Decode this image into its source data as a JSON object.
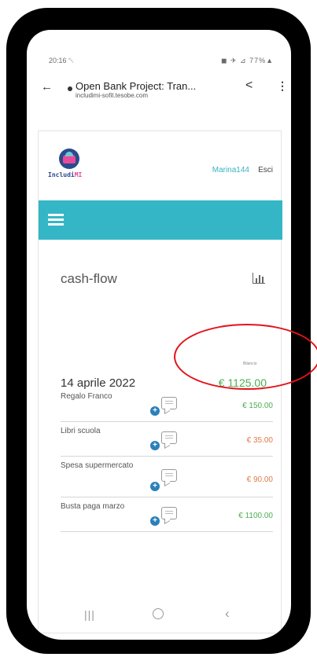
{
  "status_bar": {
    "time": "20:16 ␀",
    "icons": "◼ ✈ ⊿ 77%▲"
  },
  "browser": {
    "title": "Open Bank Project: Tran...",
    "url": "includimi-sofit.tesobe.com"
  },
  "header": {
    "logo_text_main": "Includi",
    "logo_text_accent": "MI",
    "username": "Marina144",
    "logout_label": "Esci"
  },
  "section": {
    "title": "cash-flow"
  },
  "balance": {
    "label": "Bilancio",
    "date": "14 aprile 2022",
    "value": "€ 1125.00"
  },
  "transactions": [
    {
      "name": "Regalo Franco",
      "amount": "€ 150.00",
      "type": "pos"
    },
    {
      "name": "Libri scuola",
      "amount": "€ 35.00",
      "type": "neg"
    },
    {
      "name": "Spesa supermercato",
      "amount": "€ 90.00",
      "type": "neg"
    },
    {
      "name": "Busta paga marzo",
      "amount": "€ 1100.00",
      "type": "pos"
    }
  ],
  "colors": {
    "accent_teal": "#34b6c6",
    "positive_green": "#4caf50",
    "negative_orange": "#e07a4a",
    "annotation_red": "#e3141b"
  }
}
